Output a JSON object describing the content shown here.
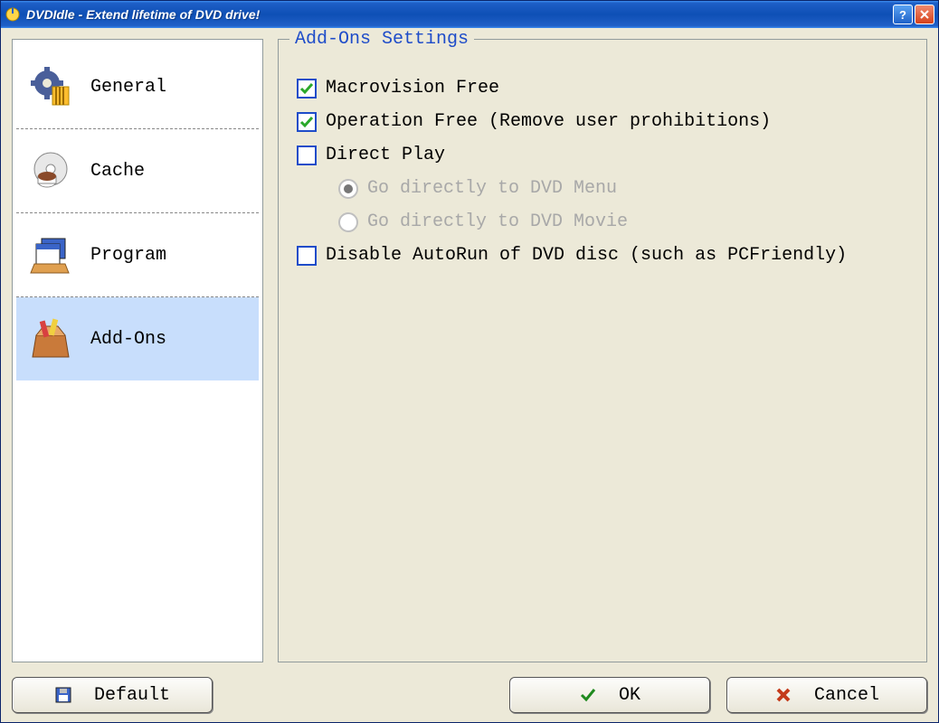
{
  "window": {
    "title": "DVDIdle - Extend lifetime of DVD drive!"
  },
  "sidebar": {
    "items": [
      {
        "label": "General"
      },
      {
        "label": "Cache"
      },
      {
        "label": "Program"
      },
      {
        "label": "Add-Ons"
      }
    ],
    "selected_index": 3
  },
  "panel": {
    "title": "Add-Ons Settings",
    "options": {
      "macrovision_label": "Macrovision Free",
      "macrovision_checked": true,
      "operation_label": "Operation Free (Remove user prohibitions)",
      "operation_checked": true,
      "directplay_label": "Direct Play",
      "directplay_checked": false,
      "directplay_menu_label": "Go directly to DVD Menu",
      "directplay_movie_label": "Go directly to DVD Movie",
      "directplay_radio_value": "menu",
      "disable_autorun_label": "Disable AutoRun of DVD disc (such as PCFriendly)",
      "disable_autorun_checked": false
    }
  },
  "buttons": {
    "default": "Default",
    "ok": "OK",
    "cancel": "Cancel"
  }
}
